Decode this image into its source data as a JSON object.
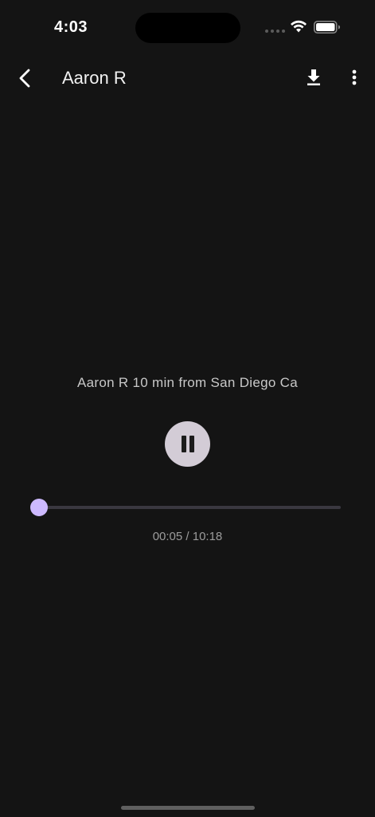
{
  "status_bar": {
    "time": "4:03"
  },
  "app_bar": {
    "title": "Aaron R",
    "icons": [
      "back-icon",
      "download-icon",
      "more-vertical-icon"
    ]
  },
  "player": {
    "track_title": "Aaron R 10 min from San Diego Ca",
    "state": "playing",
    "elapsed": "00:05",
    "duration": "10:18",
    "time_readout": "00:05 / 10:18",
    "progress_fraction": 0.008
  },
  "colors": {
    "background": "#141414",
    "accent": "#cdb9ff",
    "pause_button": "#d3ccd6"
  }
}
